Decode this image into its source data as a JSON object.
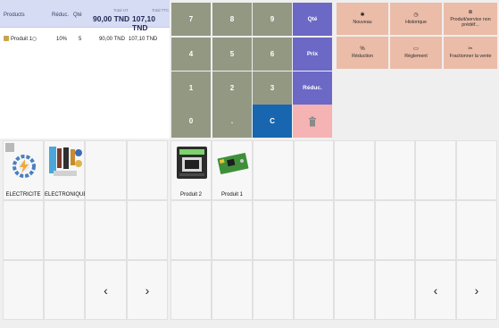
{
  "cart": {
    "headers": {
      "products": "Products",
      "discount": "Réduc.",
      "qty": "Qté",
      "total_ht_label": "Total HT",
      "total_ht": "90,00 TND",
      "total_ttc_label": "Total TTC",
      "total_ttc": "107,10 TND"
    },
    "lines": [
      {
        "name": "Produit 1",
        "discount": "10%",
        "qty": "5",
        "ht": "90,00 TND",
        "ttc": "107,10 TND"
      }
    ]
  },
  "keypad": {
    "keys": [
      "7",
      "8",
      "9",
      "4",
      "5",
      "6",
      "1",
      "2",
      "3",
      "0",
      "."
    ],
    "qty": "Qté",
    "price": "Prix",
    "discount": "Réduc.",
    "clear": "C"
  },
  "actions": [
    {
      "label": "Nouveau",
      "icon": "new-icon"
    },
    {
      "label": "Historique",
      "icon": "history-icon"
    },
    {
      "label": "Produit/service non prédéf...",
      "icon": "free-product-icon"
    },
    {
      "label": "Réduction",
      "icon": "percent-icon"
    },
    {
      "label": "Règlement",
      "icon": "payment-icon"
    },
    {
      "label": "Fractionner la vente",
      "icon": "split-icon"
    }
  ],
  "categories": [
    {
      "label": "ELECTRICITE",
      "icon": "electricity-icon"
    },
    {
      "label": "ELECTRONIQUE",
      "icon": "electronics-icon"
    }
  ],
  "products": [
    {
      "label": "Produit 2",
      "icon": "meter-device-icon"
    },
    {
      "label": "Produit 1",
      "icon": "circuit-board-icon"
    }
  ],
  "nav": {
    "prev": "‹",
    "next": "›"
  },
  "colors": {
    "keypad_digit": "#939883",
    "keypad_op": "#6b68c6",
    "clear": "#1866b0",
    "delete": "#f5b3b3",
    "action": "#ebbca8",
    "header": "#d6dcf3"
  }
}
